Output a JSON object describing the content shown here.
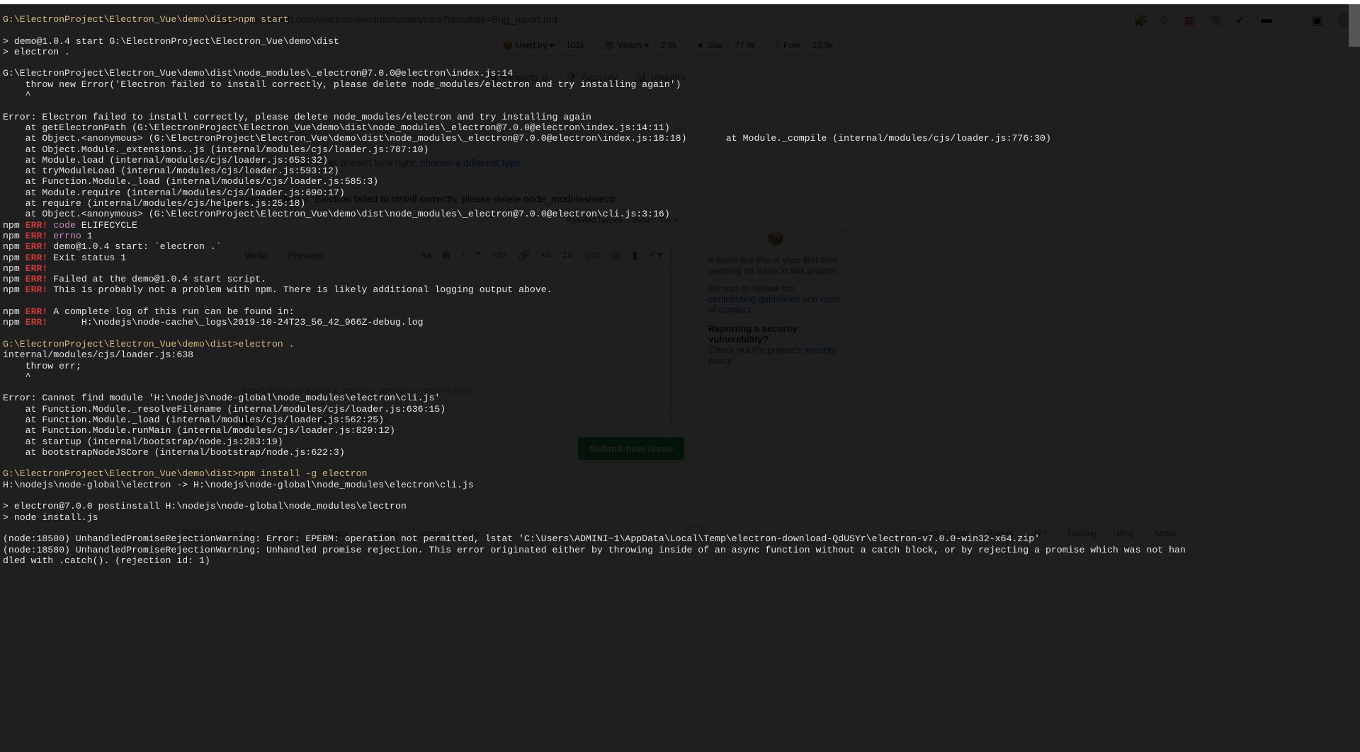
{
  "url": "https://github.com/electron/electron/issues/new?template=Bug_report.md",
  "repo_actions": {
    "used_by": {
      "label": "Used by",
      "count": "101k"
    },
    "watch": {
      "label": "Watch",
      "count": "2.8k"
    },
    "star": {
      "label": "Star",
      "count": "77.9k"
    },
    "fork": {
      "label": "Fork",
      "count": "10.3k"
    }
  },
  "nav": {
    "projects": "Projects",
    "security": "Security",
    "insights": "Insights"
  },
  "blurb_prefix": "improve Electron. If this doesn't look right, ",
  "blurb_link": "choose a different type.",
  "issue_title_value": "electron always \"Electron failed to install correctly, please delete node_modules/electr",
  "related": {
    "label": "Related Issues",
    "beta": "Beta",
    "try": "Try it."
  },
  "editor": {
    "write": "Write",
    "preview": "Preview",
    "attach_hint": "Attach files by dragging & dropping, selecting or pasting them.",
    "md_hint": "Styling with Markdown is supported"
  },
  "submit_label": "Submit new issue",
  "popup": {
    "p1": "It looks like this is your first time opening an issue in this project!",
    "p2a": "Be sure to review the ",
    "link1": "contributing guidelines",
    "p2b": " and ",
    "link2": "code of conduct",
    "sec_head": "Reporting a security vulnerability?",
    "sec_body": "Check out the project's ",
    "sec_link": "security policy"
  },
  "footer": {
    "copyright": "© 2019 GitHub, Inc.",
    "links": [
      "Terms",
      "Privacy",
      "Security",
      "Status",
      "Help",
      "Contact GitHub",
      "Pricing",
      "API",
      "Training",
      "Blog",
      "About"
    ]
  },
  "terminal": {
    "l1": "G:\\ElectronProject\\Electron_Vue\\demo\\dist>npm start",
    "l3": "> demo@1.0.4 start G:\\ElectronProject\\Electron_Vue\\demo\\dist",
    "l4": "> electron .",
    "l6": "G:\\ElectronProject\\Electron_Vue\\demo\\dist\\node_modules\\_electron@7.0.0@electron\\index.js:14",
    "l7": "    throw new Error('Electron failed to install correctly, please delete node_modules/electron and try installing again')",
    "l8": "    ^",
    "l10": "Error: Electron failed to install correctly, please delete node_modules/electron and try installing again",
    "l11": "    at getElectronPath (G:\\ElectronProject\\Electron_Vue\\demo\\dist\\node_modules\\_electron@7.0.0@electron\\index.js:14:11)",
    "l12": "    at Object.<anonymous> (G:\\ElectronProject\\Electron_Vue\\demo\\dist\\node_modules\\_electron@7.0.0@electron\\index.js:18:18)       at Module._compile (internal/modules/cjs/loader.js:776:30)",
    "l13": "    at Object.Module._extensions..js (internal/modules/cjs/loader.js:787:10)",
    "l14": "    at Module.load (internal/modules/cjs/loader.js:653:32)",
    "l15": "    at tryModuleLoad (internal/modules/cjs/loader.js:593:12)",
    "l16": "    at Function.Module._load (internal/modules/cjs/loader.js:585:3)",
    "l17": "    at Module.require (internal/modules/cjs/loader.js:690:17)",
    "l18": "    at require (internal/modules/cjs/helpers.js:25:18)",
    "l19": "    at Object.<anonymous> (G:\\ElectronProject\\Electron_Vue\\demo\\dist\\node_modules\\_electron@7.0.0@electron\\cli.js:3:16)",
    "npm": "npm",
    "err": "ERR!",
    "e1a": "code",
    "e1b": "ELIFECYCLE",
    "e2a": "errno",
    "e2b": "1",
    "e3": "demo@1.0.4 start: `electron .`",
    "e4": "Exit status 1",
    "e6": "Failed at the demo@1.0.4 start script.",
    "e7": "This is probably not a problem with npm. There is likely additional logging output above.",
    "e9": "A complete log of this run can be found in:",
    "e10": "     H:\\nodejs\\node-cache\\_logs\\2019-10-24T23_56_42_966Z-debug.log",
    "l30": "G:\\ElectronProject\\Electron_Vue\\demo\\dist>electron .",
    "l31": "internal/modules/cjs/loader.js:638",
    "l32": "    throw err;",
    "l33": "    ^",
    "l35": "Error: Cannot find module 'H:\\nodejs\\node-global\\node_modules\\electron\\cli.js'",
    "l36": "    at Function.Module._resolveFilename (internal/modules/cjs/loader.js:636:15)",
    "l37": "    at Function.Module._load (internal/modules/cjs/loader.js:562:25)",
    "l38": "    at Function.Module.runMain (internal/modules/cjs/loader.js:829:12)",
    "l39": "    at startup (internal/bootstrap/node.js:283:19)",
    "l40": "    at bootstrapNodeJSCore (internal/bootstrap/node.js:622:3)",
    "l42": "G:\\ElectronProject\\Electron_Vue\\demo\\dist>npm install -g electron",
    "l43": "H:\\nodejs\\node-global\\electron -> H:\\nodejs\\node-global\\node_modules\\electron\\cli.js",
    "l45": "> electron@7.0.0 postinstall H:\\nodejs\\node-global\\node_modules\\electron",
    "l46": "> node install.js",
    "l48": "(node:18580) UnhandledPromiseRejectionWarning: Error: EPERM: operation not permitted, lstat 'C:\\Users\\ADMINI~1\\AppData\\Local\\Temp\\electron-download-QdUSYr\\electron-v7.0.0-win32-x64.zip'",
    "l49": "(node:18580) UnhandledPromiseRejectionWarning: Unhandled promise rejection. This error originated either by throwing inside of an async function without a catch block, or by rejecting a promise which was not han",
    "l50": "dled with .catch(). (rejection id: 1)"
  }
}
